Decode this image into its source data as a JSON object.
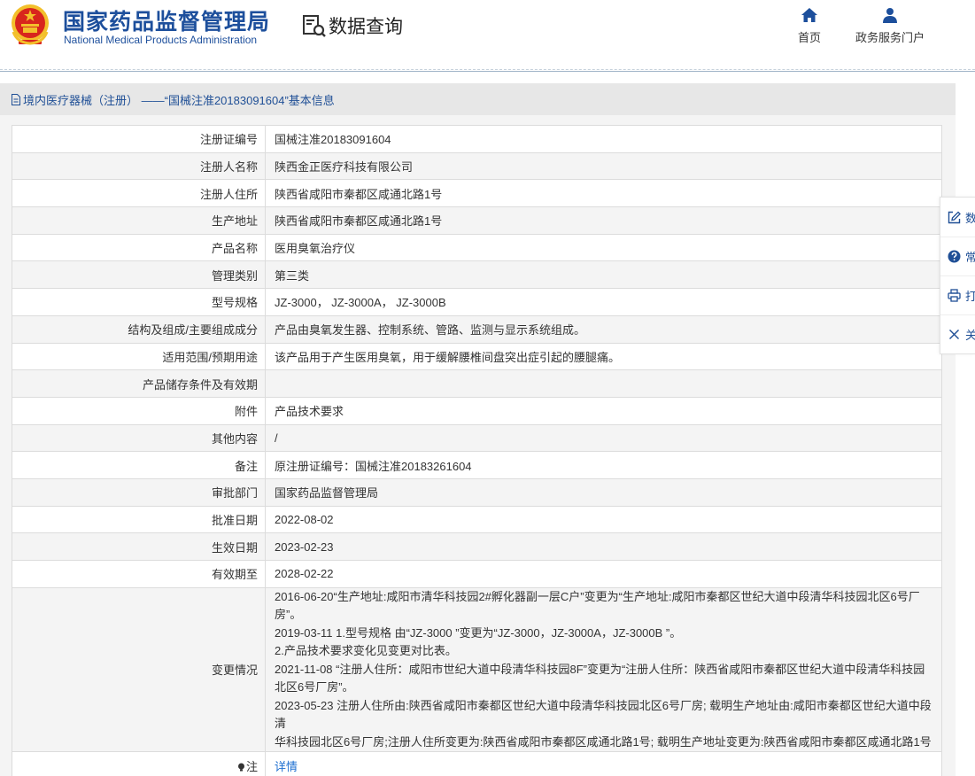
{
  "header": {
    "org_cn": "国家药品监督管理局",
    "org_en": "National Medical Products Administration",
    "query_label": "数据查询",
    "nav": [
      {
        "label": "首页",
        "icon": "home-icon"
      },
      {
        "label": "政务服务门户",
        "icon": "user-icon"
      }
    ]
  },
  "colors": {
    "brand_blue": "#1d4f9c",
    "link_blue": "#1d6fd0",
    "emblem_red": "#d8261d",
    "emblem_gold": "#f3c02b"
  },
  "panel": {
    "title": "境内医疗器械（注册） ——“国械注准20183091604”基本信息"
  },
  "table": {
    "rows": [
      {
        "label": "注册证编号",
        "value": "国械注准20183091604"
      },
      {
        "label": "注册人名称",
        "value": "陕西金正医疗科技有限公司"
      },
      {
        "label": "注册人住所",
        "value": "陕西省咸阳市秦都区咸通北路1号"
      },
      {
        "label": "生产地址",
        "value": "陕西省咸阳市秦都区咸通北路1号"
      },
      {
        "label": "产品名称",
        "value": "医用臭氧治疗仪"
      },
      {
        "label": "管理类别",
        "value": "第三类"
      },
      {
        "label": "型号规格",
        "value": "JZ-3000， JZ-3000A， JZ-3000B"
      },
      {
        "label": "结构及组成/主要组成成分",
        "value": "产品由臭氧发生器、控制系统、管路、监测与显示系统组成。"
      },
      {
        "label": "适用范围/预期用途",
        "value": "该产品用于产生医用臭氧，用于缓解腰椎间盘突出症引起的腰腿痛。"
      },
      {
        "label": "产品储存条件及有效期",
        "value": ""
      },
      {
        "label": "附件",
        "value": "产品技术要求"
      },
      {
        "label": "其他内容",
        "value": "/"
      },
      {
        "label": "备注",
        "value": "原注册证编号：国械注准20183261604"
      },
      {
        "label": "审批部门",
        "value": "国家药品监督管理局"
      },
      {
        "label": "批准日期",
        "value": "2022-08-02"
      },
      {
        "label": "生效日期",
        "value": "2023-02-23"
      },
      {
        "label": "有效期至",
        "value": "2028-02-22"
      }
    ],
    "changes": {
      "label": "变更情况",
      "lines": [
        "2016-06-20“生产地址:咸阳市清华科技园2#孵化器副一层C户”变更为“生产地址:咸阳市秦都区世纪大道中段清华科技园北区6号厂",
        "房”。",
        "2019-03-11 1.型号规格 由“JZ-3000 ”变更为“JZ-3000，JZ-3000A，JZ-3000B ”。",
        "2.产品技术要求变化见变更对比表。",
        "2021-11-08 “注册人住所：咸阳市世纪大道中段清华科技园8F”变更为“注册人住所：陕西省咸阳市秦都区世纪大道中段清华科技园",
        "北区6号厂房”。",
        "2023-05-23 注册人住所由:陕西省咸阳市秦都区世纪大道中段清华科技园北区6号厂房; 载明生产地址由:咸阳市秦都区世纪大道中段清",
        "华科技园北区6号厂房;注册人住所变更为:陕西省咸阳市秦都区咸通北路1号; 载明生产地址变更为:陕西省咸阳市秦都区咸通北路1号"
      ]
    },
    "note": {
      "label": "注",
      "link": "详情"
    }
  },
  "float_bar": [
    {
      "label": "数",
      "icon": "edit-icon"
    },
    {
      "label": "常",
      "icon": "help-icon"
    },
    {
      "label": "打",
      "icon": "print-icon"
    },
    {
      "label": "关",
      "icon": "close-icon"
    }
  ]
}
